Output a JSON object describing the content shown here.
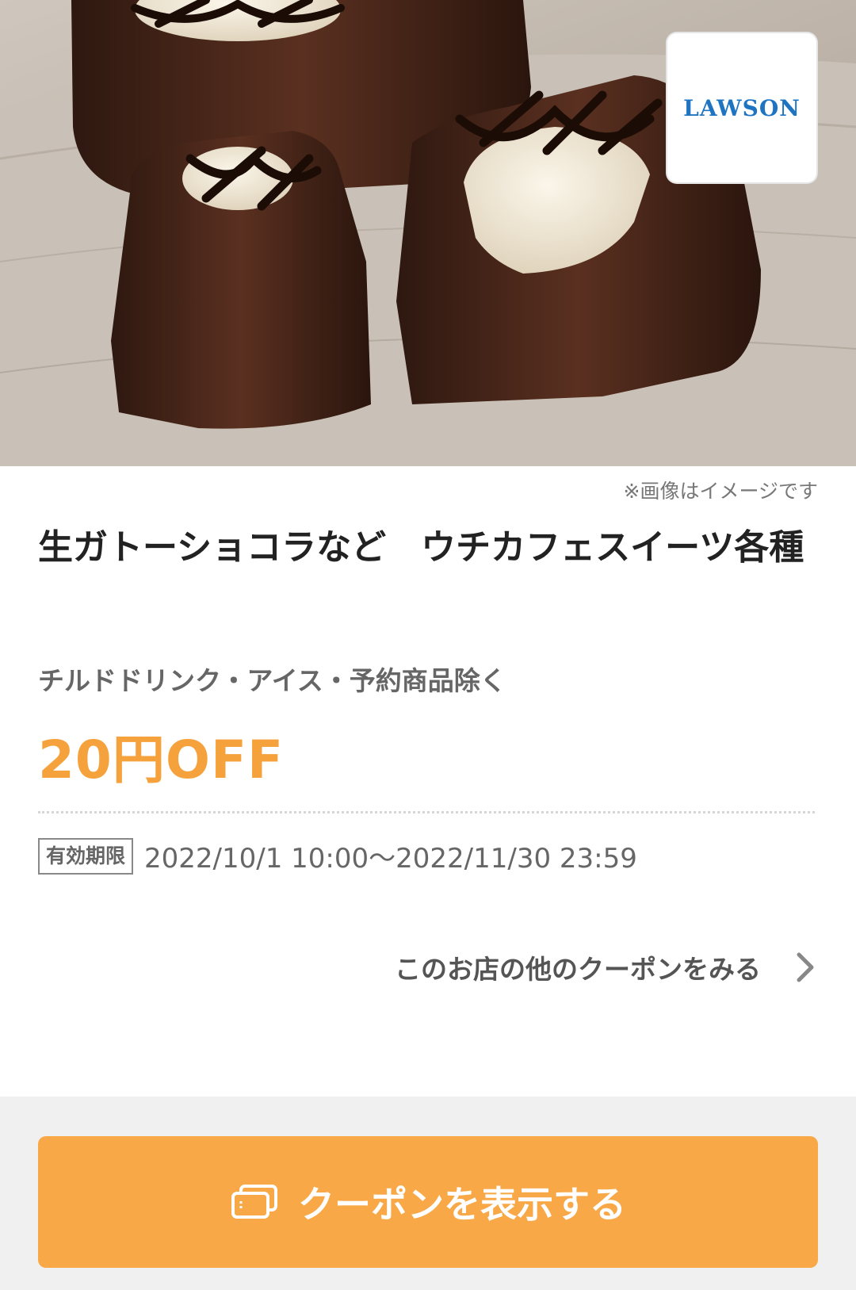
{
  "hero": {
    "image_subject": "chocolate-gateau-photo",
    "store_logo_text": "LAWSON",
    "store_logo_color": "#1f74c2"
  },
  "coupon": {
    "image_note": "※画像はイメージです",
    "title": "生ガトーショコラなど　ウチカフェスイーツ各種",
    "condition": "チルドドリンク・アイス・予約商品除く",
    "discount": "20円OFF",
    "discount_color": "#f6a23c",
    "validity_label": "有効期限",
    "validity_period": "2022/10/1 10:00〜2022/11/30  23:59"
  },
  "links": {
    "more_coupons": "このお店の他のクーポンをみる",
    "more_icon": "chevron-right-icon"
  },
  "footer": {
    "button_label": "クーポンを表示する",
    "button_icon": "coupon-cards-icon",
    "button_color": "#f8a847"
  }
}
